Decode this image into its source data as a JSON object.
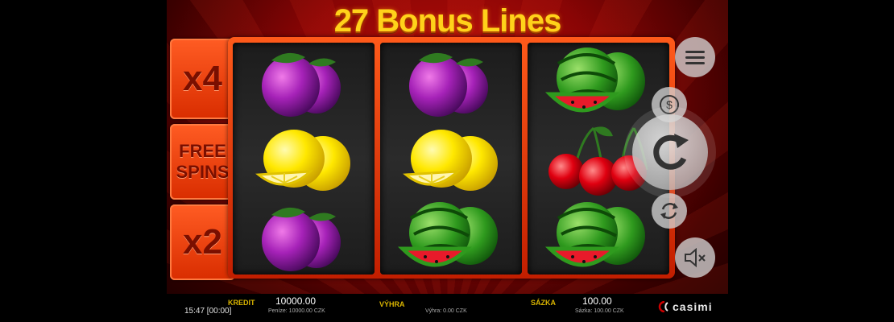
{
  "title": "27 Bonus Lines",
  "multipliers": [
    "x4",
    "FREE SPINS",
    "x2"
  ],
  "reels": [
    [
      "plum",
      "lemon",
      "plum"
    ],
    [
      "plum",
      "lemon",
      "watermelon"
    ],
    [
      "watermelon",
      "cherries",
      "watermelon"
    ]
  ],
  "controls": {
    "menu_icon": "menu-icon",
    "bet_icon": "dollar-coin-icon",
    "spin_icon": "spin-arrow-icon",
    "autoplay_icon": "autoplay-icon",
    "sound_icon": "sound-muted-icon"
  },
  "status_bar": {
    "clock": "15:47 [00:00]",
    "credit_label": "KREDIT",
    "credit_value": "10000.00",
    "credit_sub": "Peníze: 10000.00 CZK",
    "win_label": "VÝHRA",
    "win_sub": "Výhra: 0.00 CZK",
    "bet_label": "SÁZKA",
    "bet_value": "100.00",
    "bet_sub": "Sázka: 100.00 CZK",
    "brand": "casimi"
  },
  "colors": {
    "title": "#ffd21a",
    "frame": "#ff5a1a",
    "background": "#8a0505",
    "label": "#d9b400"
  }
}
